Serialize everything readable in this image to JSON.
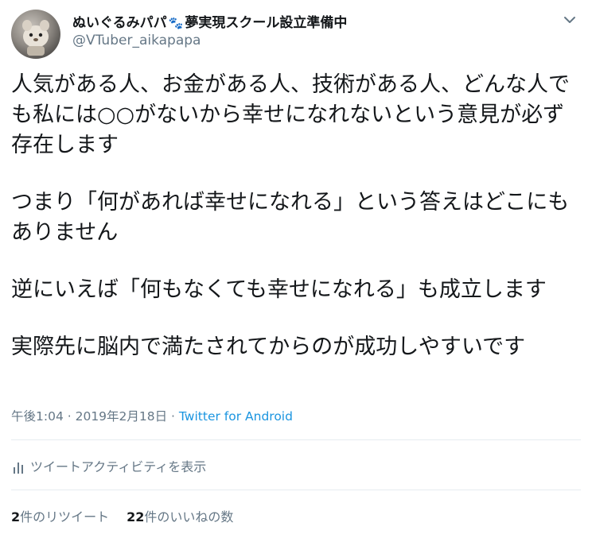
{
  "header": {
    "display_name": "ぬいぐるみパパ",
    "display_name_suffix": "夢実現スクール設立準備中",
    "handle": "@VTuber_aikapapa",
    "emoji_icon": "paw-prints-icon",
    "menu_icon": "chevron-down-icon"
  },
  "tweet": {
    "paragraphs": [
      "人気がある人、お金がある人、技術がある人、どんな人でも私には○○がないから幸せになれないという意見が必ず存在します",
      "つまり「何があれば幸せになれる」という答えはどこにもありません",
      "逆にいえば「何もなくても幸せになれる」も成立します",
      "実際先に脳内で満たされてからのが成功しやすいです"
    ]
  },
  "meta": {
    "time": "午後1:04",
    "separator": " · ",
    "date": "2019年2月18日",
    "source": "Twitter for Android"
  },
  "activity": {
    "icon": "bar-chart-icon",
    "label": "ツイートアクティビティを表示"
  },
  "stats": {
    "retweets_count": "2",
    "retweets_label": "件のリツイート",
    "likes_count": "22",
    "likes_label": "件のいいねの数"
  },
  "colors": {
    "text": "#14171a",
    "secondary": "#657786",
    "link": "#1b95e0",
    "divider": "#e6ecf0"
  }
}
